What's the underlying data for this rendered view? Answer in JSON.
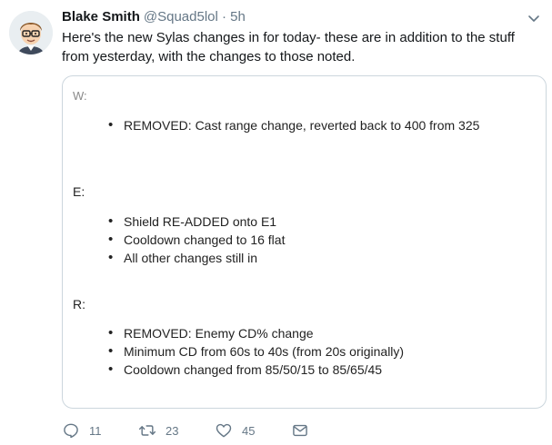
{
  "tweet": {
    "display_name": "Blake Smith",
    "handle": "@Squad5lol",
    "separator": "·",
    "time": "5h",
    "text": "Here's the new Sylas changes in for today- these are in addition to the stuff from yesterday, with the changes to those noted."
  },
  "media": {
    "sections": [
      {
        "label": "W:",
        "items": [
          "REMOVED: Cast range change, reverted back to 400 from 325"
        ]
      },
      {
        "label": "E:",
        "items": [
          "Shield RE-ADDED onto E1",
          "Cooldown changed to 16 flat",
          "All other changes still in"
        ]
      },
      {
        "label": "R:",
        "items": [
          "REMOVED: Enemy CD% change",
          "Minimum CD from 60s to 40s (from 20s originally)",
          "Cooldown changed from 85/50/15 to 85/65/45"
        ]
      }
    ]
  },
  "actions": {
    "reply_count": "11",
    "retweet_count": "23",
    "like_count": "45"
  },
  "icons": {
    "avatar": "cartoon-avatar",
    "caret": "chevron-down-icon",
    "reply": "reply-icon",
    "retweet": "retweet-icon",
    "like": "heart-icon",
    "dm": "envelope-icon"
  },
  "colors": {
    "text": "#14171a",
    "secondary": "#657786",
    "border": "#ccd6dd"
  }
}
